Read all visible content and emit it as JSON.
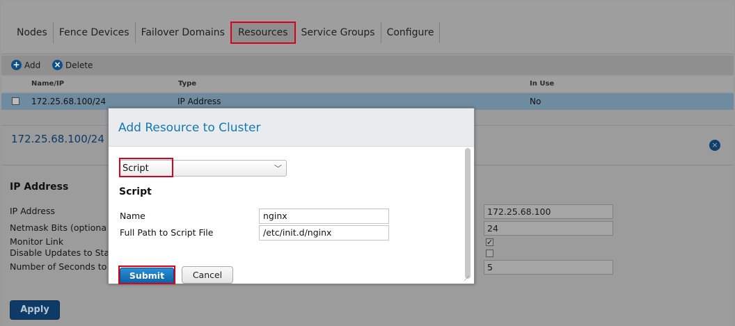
{
  "tabs": [
    "Nodes",
    "Fence Devices",
    "Failover Domains",
    "Resources",
    "Service Groups",
    "Configure"
  ],
  "active_tab": "Resources",
  "toolbar": {
    "add_label": "Add",
    "delete_label": "Delete"
  },
  "table": {
    "headers": {
      "name": "Name/IP",
      "type": "Type",
      "in_use": "In Use"
    },
    "rows": [
      {
        "name": "172.25.68.100/24",
        "type": "IP Address",
        "in_use": "No"
      }
    ]
  },
  "detail": {
    "title": "172.25.68.100/24",
    "section": "IP Address",
    "fields": {
      "ip_address": {
        "label": "IP Address",
        "value": "172.25.68.100"
      },
      "netmask": {
        "label": "Netmask Bits (optiona",
        "value": "24"
      },
      "monitor_link": {
        "label": "Monitor Link",
        "checked": true
      },
      "disable_updates": {
        "label": "Disable Updates to Sta",
        "checked": false
      },
      "num_seconds": {
        "label": "Number of Seconds to",
        "value": "5"
      }
    },
    "apply_label": "Apply"
  },
  "modal": {
    "title": "Add Resource to Cluster",
    "resource_type": "Script",
    "section": "Script",
    "name_label": "Name",
    "name_value": "nginx",
    "path_label": "Full Path to Script File",
    "path_value": "/etc/init.d/nginx",
    "submit_label": "Submit",
    "cancel_label": "Cancel"
  },
  "colors": {
    "highlight": "#d9001b",
    "accent": "#1477b5"
  }
}
